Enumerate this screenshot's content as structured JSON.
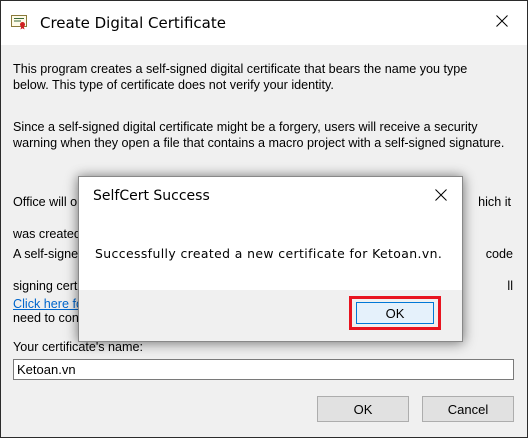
{
  "window": {
    "title": "Create Digital Certificate",
    "icon": "certificate-icon",
    "close_icon": "close-icon"
  },
  "main": {
    "paragraph1": "This program creates a self-signed digital certificate that bears the name you type below. This type of certificate does not verify your identity.",
    "paragraph2": "Since a self-signed digital certificate might be a forgery, users will receive a security warning when they open a file that contains a macro project with a self-signed signature.",
    "paragraph3_left": "Office will o",
    "paragraph3_right": "hich it",
    "paragraph3_left2": "was created",
    "paragraph4_left1": "A self-signe",
    "paragraph4_right1": "code",
    "paragraph4_left2": "signing certi",
    "paragraph4_right2": "ll",
    "paragraph4_left3": "need to con",
    "link_text": "Click here fo",
    "name_label": "Your certificate's name:",
    "name_value": "Ketoan.vn",
    "ok_label": "OK",
    "cancel_label": "Cancel"
  },
  "dialog": {
    "title": "SelfCert Success",
    "message": "Successfully created a new certificate for Ketoan.vn.",
    "ok_label": "OK",
    "highlight_color": "#e8141f"
  }
}
